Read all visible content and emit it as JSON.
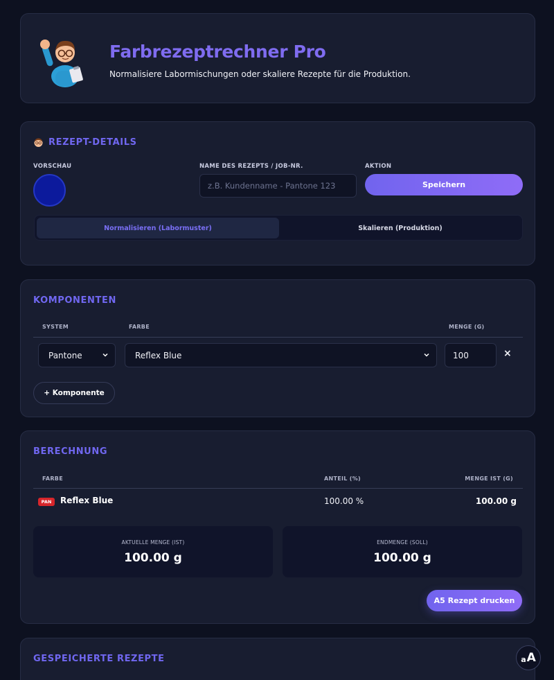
{
  "header": {
    "title": "Farbrezeptrechner Pro",
    "subtitle": "Normalisiere Labormischungen oder skaliere Rezepte für die Produktion."
  },
  "details": {
    "section_title": "REZEPT-DETAILS",
    "preview_label": "VORSCHAU",
    "preview_color": "#0c1a9c",
    "name_label": "NAME DES REZEPTS / JOB-NR.",
    "name_value": "",
    "name_placeholder": "z.B. Kundenname - Pantone 123",
    "action_label": "AKTION",
    "save_label": "Speichern",
    "modes": [
      {
        "label": "Normalisieren (Labormuster)",
        "active": true
      },
      {
        "label": "Skalieren (Produktion)",
        "active": false
      }
    ]
  },
  "components": {
    "section_title": "KOMPONENTEN",
    "headers": {
      "system": "SYSTEM",
      "color": "FARBE",
      "amount": "MENGE (G)"
    },
    "rows": [
      {
        "system": "Pantone",
        "color": "Reflex Blue",
        "amount": "100",
        "remove": "×"
      }
    ],
    "add_label": "+ Komponente"
  },
  "calculation": {
    "section_title": "BERECHNUNG",
    "headers": {
      "color": "FARBE",
      "share": "ANTEIL (%)",
      "amount": "MENGE IST (G)"
    },
    "rows": [
      {
        "badge": "PAN",
        "color": "Reflex Blue",
        "share": "100.00 %",
        "amount": "100.00 g"
      }
    ],
    "current_label": "AKTUELLE MENGE (IST)",
    "current_value": "100.00 g",
    "target_label": "ENDMENGE (SOLL)",
    "target_value": "100.00 g",
    "print_label": "A5 Rezept drucken"
  },
  "saved": {
    "section_title": "GESPEICHERTE REZEPTE"
  },
  "font_toggle": {
    "small": "a",
    "big": "A"
  },
  "colors": {
    "accent": "#7067f0",
    "background": "#0d1120",
    "card": "#181d30",
    "badge": "#d7262b"
  }
}
